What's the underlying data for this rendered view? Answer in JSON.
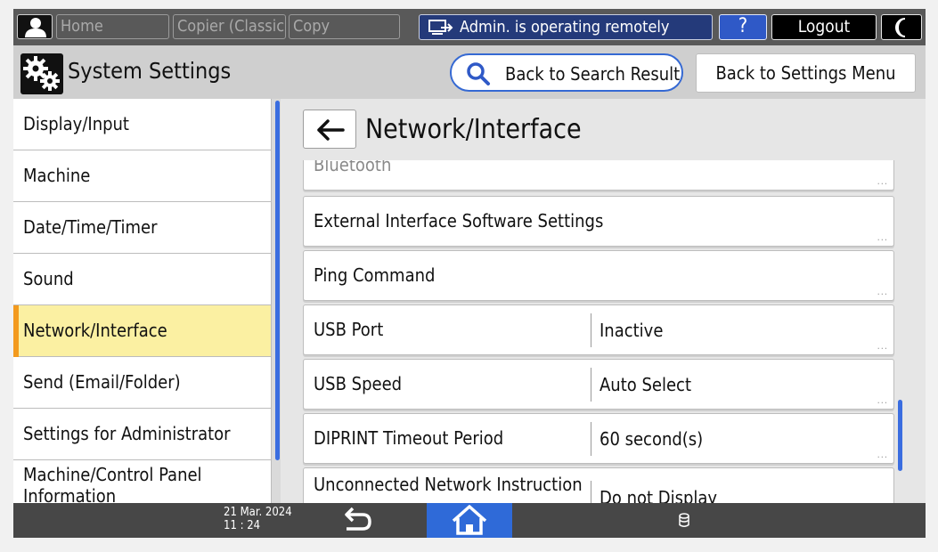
{
  "topbar": {
    "home_tab": "Home",
    "copier_classic_tab": "Copier (Classic)",
    "copy_tab": "Copy",
    "admin_status": "Admin. is operating remotely",
    "help_label": "?",
    "logout_label": "Logout"
  },
  "header": {
    "title": "System Settings",
    "back_search_label": "Back to Search Result",
    "back_menu_label": "Back to Settings Menu"
  },
  "sidebar": {
    "items": [
      {
        "label": "Display/Input"
      },
      {
        "label": "Machine"
      },
      {
        "label": "Date/Time/Timer"
      },
      {
        "label": "Sound"
      },
      {
        "label": "Network/Interface"
      },
      {
        "label": "Send (Email/Folder)"
      },
      {
        "label": "Settings for Administrator"
      },
      {
        "label": "Machine/Control Panel",
        "label2": "Information"
      }
    ],
    "active_index": 4
  },
  "main": {
    "title": "Network/Interface",
    "rows": [
      {
        "name": "Bluetooth",
        "value": ""
      },
      {
        "name": "External Interface Software Settings",
        "value": ""
      },
      {
        "name": "Ping Command",
        "value": ""
      },
      {
        "name": "USB Port",
        "value": "Inactive"
      },
      {
        "name": "USB Speed",
        "value": "Auto Select"
      },
      {
        "name": "DIPRINT Timeout Period",
        "value": "60 second(s)"
      },
      {
        "name": "Unconnected Network Instruction",
        "value": "Do not Display"
      }
    ],
    "more_indicator": "..."
  },
  "bottombar": {
    "date": "21 Mar. 2024",
    "time": "11 : 24"
  },
  "colors": {
    "accent_blue": "#2f6ad8",
    "active_highlight": "#fbf0a2",
    "active_marker": "#f39a1e",
    "admin_banner": "#243a7a"
  }
}
